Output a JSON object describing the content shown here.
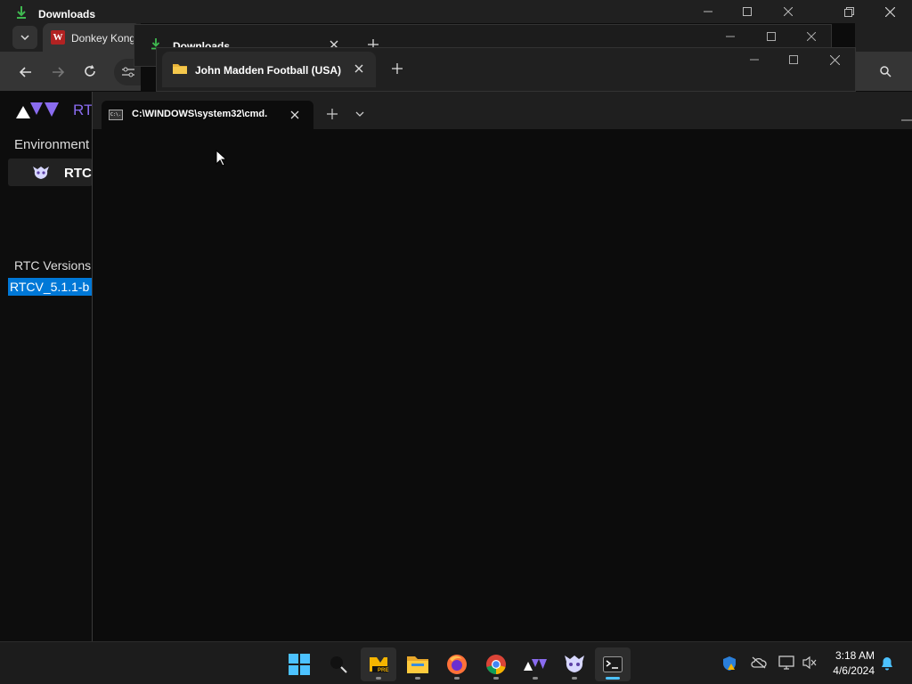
{
  "downloads_back": {
    "title": "Downloads"
  },
  "browser": {
    "tab_title": "Donkey Kong",
    "favicon_letter": "W"
  },
  "rtc": {
    "logo_text": "RTC",
    "environment_label": "Environment",
    "env_item_label": "RTCV",
    "versions_label": "RTC Versions",
    "selected_version": "RTCV_5.1.1-b"
  },
  "downloads_mid": {
    "tab_title": "Downloads"
  },
  "explorer": {
    "tab_title": "John Madden Football (USA)"
  },
  "terminal": {
    "tab_title": "C:\\WINDOWS\\system32\\cmd.",
    "icon_text": "C:\\."
  },
  "taskbar": {
    "apps": [
      "start",
      "search",
      "app-pre",
      "file-explorer",
      "firefox",
      "chrome",
      "rtcv",
      "rtcv-alt",
      "terminal"
    ],
    "pre_badge": "PRE",
    "time": "3:18 AM",
    "date": "4/6/2024"
  },
  "colors": {
    "accent": "#4cc2ff",
    "rtc_purple": "#8a6cf0",
    "selection": "#0078d7"
  }
}
